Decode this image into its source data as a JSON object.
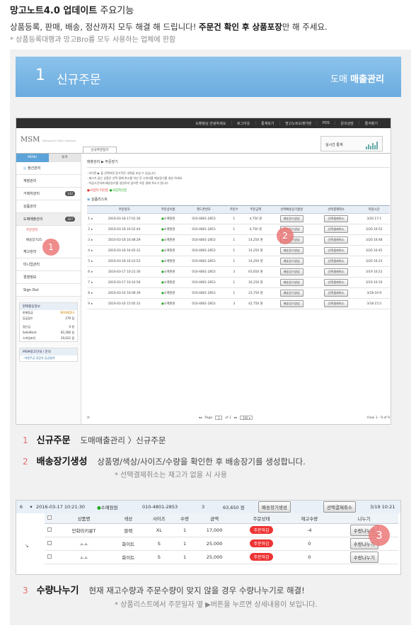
{
  "header": {
    "title_bold": "망고노트4.0 업데이트",
    "title_rest": " 주요기능"
  },
  "intro": {
    "text_before": "상품등록, 판매, 배송, 정산까지 모두 해결 해 드립니다! ",
    "text_bold": "주문건 확인 후 상품포장",
    "text_after": "만 해 주세요.",
    "note": "* 상품등록대행과 망고Bro를 모두 사용하는 업체에 한함"
  },
  "section": {
    "num": "1",
    "title": "신규주문",
    "right_prefix": "도매",
    "right_bold": "매출관리"
  },
  "app": {
    "topnav": [
      "도매핑님 안녕하세요",
      "로그아웃",
      "통계보기",
      "망고노트도매가렌",
      "POS",
      "문의상담",
      "즐겨찾기"
    ],
    "logo": "MSM",
    "logo_sub": "Mangonote Sales Manager",
    "active_tab": "신규주문장기",
    "stat_label": "실시간 통계",
    "sidebar": {
      "menu_on": "MENU",
      "menu_off": "통계",
      "items": [
        {
          "label": "정산관리",
          "count": ""
        },
        {
          "label": "계정관리",
          "count": ""
        },
        {
          "label": "거래처관리",
          "count": "142"
        },
        {
          "label": "상품관리",
          "count": ""
        },
        {
          "label": "도매매출관리",
          "count": "427"
        }
      ],
      "sub_items": [
        {
          "label": "주문관리",
          "count": ""
        },
        {
          "label": "배송장기",
          "count": "25"
        }
      ],
      "items2": [
        "재고관리",
        "미니업관리",
        "경영정보",
        "Sign Out"
      ],
      "info_title": "판매활동정보",
      "info_rows": [
        {
          "k": "판매등급",
          "v": "BRONZE4"
        },
        {
          "k": "등급점수",
          "v": "279 점"
        },
        {
          "k": "정산금",
          "v": "0 원"
        },
        {
          "k": "SellaPoint",
          "v": "81,580 점"
        },
        {
          "k": "스마일포인",
          "v": "20,622 점"
        }
      ],
      "ad_title": "MSM광고안내 / 문의",
      "ad_text": "· 미발주급 걸감지 입금발처"
    },
    "breadcrumb": "매출관리 ▶ 주문장기",
    "notes": [
      "· 아이콘 ▶ 을 선택하면 장기주문 내역을 보실 수 있습니다.",
      "· 재고가 없는 상품은 선택 결제 취소를 하신 후 나머지를 배송장기를 생성 하세요.",
      "· 마감시간내에 배송장기를 생성하지 않으면 자동 결제 취소가 됩니다."
    ],
    "legend_red": "●사업자 미인증",
    "legend_green": "●사업자인증",
    "list_title": "상품리스트",
    "columns": [
      "",
      "",
      "주문일자",
      "주문상이름",
      "핸드폰번호",
      "주문수",
      "주문금액",
      "선택배송장기생성",
      "선택결제취소",
      "마감시간"
    ],
    "rows": [
      {
        "no": "1",
        "date": "2016-03-18 17:01:30",
        "name": "소매원원",
        "phone": "010-4801-2853",
        "qty": "1",
        "amt": "4,750 원",
        "b1": "배송장기생성",
        "b2": "선택결제취소",
        "due": "3/20 17:1"
      },
      {
        "no": "2",
        "date": "2016-03-18 16:52:44",
        "name": "소매원원",
        "phone": "010-4801-2853",
        "qty": "1",
        "amt": "4,750 원",
        "b1": "배송장기생성",
        "b2": "선택결제취소",
        "due": "3/20 16:52"
      },
      {
        "no": "3",
        "date": "2016-03-18 16:48:29",
        "name": "소매원원",
        "phone": "010-4801-2853",
        "qty": "1",
        "amt": "14,250 원",
        "b1": "배송장기생성",
        "b2": "선택결제취소",
        "due": "3/20 16:48"
      },
      {
        "no": "4",
        "date": "2016-03-18 16:45:31",
        "name": "소매원원",
        "phone": "010-4801-2853",
        "qty": "1",
        "amt": "14,250 원",
        "b1": "배송장기생성",
        "b2": "선택결제취소",
        "due": "3/20 16:45"
      },
      {
        "no": "5",
        "date": "2016-03-18 16:23:53",
        "name": "소매원원",
        "phone": "010-4801-2853",
        "qty": "1",
        "amt": "14,250 원",
        "b1": "배송장기생성",
        "b2": "선택결제취소",
        "due": "3/20 16:23"
      },
      {
        "no": "6",
        "date": "2016-03-17 10:21:30",
        "name": "소매원원",
        "phone": "010-4801-2853",
        "qty": "3",
        "amt": "63,650 원",
        "b1": "배송장기생성",
        "b2": "선택결제취소",
        "due": "3/19 10:21"
      },
      {
        "no": "7",
        "date": "2016-03-17 10:10:56",
        "name": "소매원원",
        "phone": "010-4801-2853",
        "qty": "1",
        "amt": "16,150 원",
        "b1": "배송장기생성",
        "b2": "선택결제취소",
        "due": "3/19 10:10"
      },
      {
        "no": "8",
        "date": "2016-03-16 16:09:39",
        "name": "소매원원",
        "phone": "010-4801-2853",
        "qty": "1",
        "amt": "23,750 원",
        "b1": "배송장기생성",
        "b2": "선택결제취소",
        "due": "3/18 16:9"
      },
      {
        "no": "9",
        "date": "2016-03-16 15:05:31",
        "name": "소매원원",
        "phone": "010-4801-2853",
        "qty": "3",
        "amt": "42,750 원",
        "b1": "배송장기생성",
        "b2": "선택결제취소",
        "due": "3/18 15:5"
      }
    ],
    "pager": {
      "page": "Page",
      "cur": "1",
      "of": "of 1",
      "size": "200 ▾",
      "view": "View 1 - 9 of 9"
    }
  },
  "markers": [
    "1",
    "2",
    "3"
  ],
  "steps": [
    {
      "n": "1",
      "title": "신규주문",
      "desc": "도매매출관리 〉신규주문"
    },
    {
      "n": "2",
      "title": "배송장기생성",
      "desc": "상품명/색상/사이즈/수량을 확인한 후 배송장기를 생성합니다.",
      "note": "* 선택결제취소는 재고가 없을 시 사용"
    },
    {
      "n": "3",
      "title": "수량나누기",
      "desc": "현재 재고수량과 주문수량이 맞지 않을 경우 수량나누기로 해결!",
      "note": "* 상품리스트에서 주문일자 옆 ▶버튼을 누르면 상세내용이 보입니다."
    }
  ],
  "detail": {
    "top": {
      "no": "6",
      "arrow": "▾",
      "date": "2016-03-17 10:21:30",
      "name": "소매원원",
      "phone": "010-4801-2853",
      "qty": "3",
      "amt": "63,650 원",
      "b1": "배송장기생성",
      "b2": "선택결제취소",
      "due": "3/19 10:21"
    },
    "columns": [
      "",
      "상품명",
      "색상",
      "사이즈",
      "수량",
      "금액",
      "주문상태",
      "재고수량",
      "나누기"
    ],
    "rows": [
      {
        "name": "만화미키롱T",
        "color": "블랙",
        "size": "XL",
        "qty": "1",
        "amt": "17,000",
        "status": "주문마감",
        "stock": "-4",
        "btn": "수량나누기"
      },
      {
        "name": "ㅗㅗ",
        "color": "화이트",
        "size": "S",
        "qty": "1",
        "amt": "25,000",
        "status": "주문마감",
        "stock": "0",
        "btn": "수량나누기"
      },
      {
        "name": "ㅗㅗ",
        "color": "화이트",
        "size": "S",
        "qty": "1",
        "amt": "25,000",
        "status": "주문마감",
        "stock": "0",
        "btn": "수량나누기"
      }
    ],
    "left_mark": "↘"
  }
}
